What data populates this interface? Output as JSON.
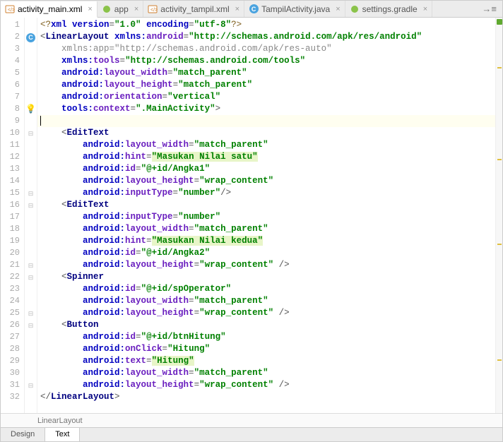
{
  "tabs": {
    "items": [
      {
        "label": "activity_main.xml",
        "icon": "xml",
        "active": true
      },
      {
        "label": "app",
        "icon": "gradle",
        "active": false
      },
      {
        "label": "activity_tampil.xml",
        "icon": "xml",
        "active": false
      },
      {
        "label": "TampilActivity.java",
        "icon": "java",
        "active": false
      },
      {
        "label": "settings.gradle",
        "icon": "gradle",
        "active": false
      }
    ]
  },
  "code": {
    "lines": [
      {
        "n": 1,
        "m": "",
        "seg": [
          [
            "decl",
            "<?"
          ],
          [
            "attr",
            "xml version"
          ],
          [
            "punct",
            "="
          ],
          [
            "str",
            "\"1.0\""
          ],
          [
            "punct",
            " "
          ],
          [
            "attr",
            "encoding"
          ],
          [
            "punct",
            "="
          ],
          [
            "str",
            "\"utf-8\""
          ],
          [
            "decl",
            "?>"
          ]
        ]
      },
      {
        "n": 2,
        "m": "class",
        "seg": [
          [
            "punct",
            "<"
          ],
          [
            "tagc",
            "LinearLayout "
          ],
          [
            "attr",
            "xmlns:"
          ],
          [
            "attrn",
            "android"
          ],
          [
            "punct",
            "="
          ],
          [
            "str",
            "\"http://schemas.android.com/apk/res/android\""
          ]
        ]
      },
      {
        "n": 3,
        "m": "",
        "seg": [
          [
            "nsgray",
            "    xmlns:app=\"http://schemas.android.com/apk/res-auto\""
          ]
        ]
      },
      {
        "n": 4,
        "m": "",
        "seg": [
          [
            "punct",
            "    "
          ],
          [
            "attr",
            "xmlns:"
          ],
          [
            "attrn",
            "tools"
          ],
          [
            "punct",
            "="
          ],
          [
            "str",
            "\"http://schemas.android.com/tools\""
          ]
        ]
      },
      {
        "n": 5,
        "m": "",
        "seg": [
          [
            "punct",
            "    "
          ],
          [
            "attr",
            "android:"
          ],
          [
            "attrn",
            "layout_width"
          ],
          [
            "punct",
            "="
          ],
          [
            "str",
            "\"match_parent\""
          ]
        ]
      },
      {
        "n": 6,
        "m": "",
        "seg": [
          [
            "punct",
            "    "
          ],
          [
            "attr",
            "android:"
          ],
          [
            "attrn",
            "layout_height"
          ],
          [
            "punct",
            "="
          ],
          [
            "str",
            "\"match_parent\""
          ]
        ]
      },
      {
        "n": 7,
        "m": "",
        "seg": [
          [
            "punct",
            "    "
          ],
          [
            "attr",
            "android:"
          ],
          [
            "attrn",
            "orientation"
          ],
          [
            "punct",
            "="
          ],
          [
            "str",
            "\"vertical\""
          ]
        ]
      },
      {
        "n": 8,
        "m": "bulb",
        "seg": [
          [
            "punct",
            "    "
          ],
          [
            "attr",
            "tools:"
          ],
          [
            "attrn",
            "context"
          ],
          [
            "punct",
            "="
          ],
          [
            "str",
            "\".MainActivity\""
          ],
          [
            "punct",
            ">"
          ]
        ]
      },
      {
        "n": 9,
        "m": "",
        "hl": true,
        "cursor": true,
        "seg": []
      },
      {
        "n": 10,
        "m": "fold",
        "seg": [
          [
            "punct",
            "    <"
          ],
          [
            "tagc",
            "EditText"
          ]
        ]
      },
      {
        "n": 11,
        "m": "",
        "seg": [
          [
            "punct",
            "        "
          ],
          [
            "attr",
            "android:"
          ],
          [
            "attrn",
            "layout_width"
          ],
          [
            "punct",
            "="
          ],
          [
            "str",
            "\"match_parent\""
          ]
        ]
      },
      {
        "n": 12,
        "m": "",
        "seg": [
          [
            "punct",
            "        "
          ],
          [
            "attr",
            "android:"
          ],
          [
            "attrn",
            "hint"
          ],
          [
            "punct",
            "="
          ],
          [
            "hint",
            "\"Masukan Nilai satu\""
          ]
        ]
      },
      {
        "n": 13,
        "m": "",
        "seg": [
          [
            "punct",
            "        "
          ],
          [
            "attr",
            "android:"
          ],
          [
            "attrn",
            "id"
          ],
          [
            "punct",
            "="
          ],
          [
            "str",
            "\"@+id/Angka1\""
          ]
        ]
      },
      {
        "n": 14,
        "m": "",
        "seg": [
          [
            "punct",
            "        "
          ],
          [
            "attr",
            "android:"
          ],
          [
            "attrn",
            "layout_height"
          ],
          [
            "punct",
            "="
          ],
          [
            "str",
            "\"wrap_content\""
          ]
        ]
      },
      {
        "n": 15,
        "m": "foldend",
        "seg": [
          [
            "punct",
            "        "
          ],
          [
            "attr",
            "android:"
          ],
          [
            "attrn",
            "inputType"
          ],
          [
            "punct",
            "="
          ],
          [
            "str",
            "\"number\""
          ],
          [
            "punct",
            "/>"
          ]
        ]
      },
      {
        "n": 16,
        "m": "fold",
        "seg": [
          [
            "punct",
            "    <"
          ],
          [
            "tagc",
            "EditText"
          ]
        ]
      },
      {
        "n": 17,
        "m": "",
        "seg": [
          [
            "punct",
            "        "
          ],
          [
            "attr",
            "android:"
          ],
          [
            "attrn",
            "inputType"
          ],
          [
            "punct",
            "="
          ],
          [
            "str",
            "\"number\""
          ]
        ]
      },
      {
        "n": 18,
        "m": "",
        "seg": [
          [
            "punct",
            "        "
          ],
          [
            "attr",
            "android:"
          ],
          [
            "attrn",
            "layout_width"
          ],
          [
            "punct",
            "="
          ],
          [
            "str",
            "\"match_parent\""
          ]
        ]
      },
      {
        "n": 19,
        "m": "",
        "seg": [
          [
            "punct",
            "        "
          ],
          [
            "attr",
            "android:"
          ],
          [
            "attrn",
            "hint"
          ],
          [
            "punct",
            "="
          ],
          [
            "hint",
            "\"Masukan Nilai kedua\""
          ]
        ]
      },
      {
        "n": 20,
        "m": "",
        "seg": [
          [
            "punct",
            "        "
          ],
          [
            "attr",
            "android:"
          ],
          [
            "attrn",
            "id"
          ],
          [
            "punct",
            "="
          ],
          [
            "str",
            "\"@+id/Angka2\""
          ]
        ]
      },
      {
        "n": 21,
        "m": "foldend",
        "seg": [
          [
            "punct",
            "        "
          ],
          [
            "attr",
            "android:"
          ],
          [
            "attrn",
            "layout_height"
          ],
          [
            "punct",
            "="
          ],
          [
            "str",
            "\"wrap_content\""
          ],
          [
            "punct",
            " />"
          ]
        ]
      },
      {
        "n": 22,
        "m": "fold",
        "seg": [
          [
            "punct",
            "    <"
          ],
          [
            "tagc",
            "Spinner"
          ]
        ]
      },
      {
        "n": 23,
        "m": "",
        "seg": [
          [
            "punct",
            "        "
          ],
          [
            "attr",
            "android:"
          ],
          [
            "attrn",
            "id"
          ],
          [
            "punct",
            "="
          ],
          [
            "str",
            "\"@+id/spOperator\""
          ]
        ]
      },
      {
        "n": 24,
        "m": "",
        "seg": [
          [
            "punct",
            "        "
          ],
          [
            "attr",
            "android:"
          ],
          [
            "attrn",
            "layout_width"
          ],
          [
            "punct",
            "="
          ],
          [
            "str",
            "\"match_parent\""
          ]
        ]
      },
      {
        "n": 25,
        "m": "foldend",
        "seg": [
          [
            "punct",
            "        "
          ],
          [
            "attr",
            "android:"
          ],
          [
            "attrn",
            "layout_height"
          ],
          [
            "punct",
            "="
          ],
          [
            "str",
            "\"wrap_content\""
          ],
          [
            "punct",
            " />"
          ]
        ]
      },
      {
        "n": 26,
        "m": "fold",
        "seg": [
          [
            "punct",
            "    <"
          ],
          [
            "tagc",
            "Button"
          ]
        ]
      },
      {
        "n": 27,
        "m": "",
        "seg": [
          [
            "punct",
            "        "
          ],
          [
            "attr",
            "android:"
          ],
          [
            "attrn",
            "id"
          ],
          [
            "punct",
            "="
          ],
          [
            "str",
            "\"@+id/btnHitung\""
          ]
        ]
      },
      {
        "n": 28,
        "m": "",
        "seg": [
          [
            "punct",
            "        "
          ],
          [
            "attr",
            "android:"
          ],
          [
            "attrn",
            "onClick"
          ],
          [
            "punct",
            "="
          ],
          [
            "str",
            "\"Hitung\""
          ]
        ]
      },
      {
        "n": 29,
        "m": "",
        "seg": [
          [
            "punct",
            "        "
          ],
          [
            "attr",
            "android:"
          ],
          [
            "attrn",
            "text"
          ],
          [
            "punct",
            "="
          ],
          [
            "hint",
            "\"Hitung\""
          ]
        ]
      },
      {
        "n": 30,
        "m": "",
        "seg": [
          [
            "punct",
            "        "
          ],
          [
            "attr",
            "android:"
          ],
          [
            "attrn",
            "layout_width"
          ],
          [
            "punct",
            "="
          ],
          [
            "str",
            "\"match_parent\""
          ]
        ]
      },
      {
        "n": 31,
        "m": "foldend",
        "seg": [
          [
            "punct",
            "        "
          ],
          [
            "attr",
            "android:"
          ],
          [
            "attrn",
            "layout_height"
          ],
          [
            "punct",
            "="
          ],
          [
            "str",
            "\"wrap_content\""
          ],
          [
            "punct",
            " />"
          ]
        ]
      },
      {
        "n": 32,
        "m": "",
        "seg": [
          [
            "punct",
            "</"
          ],
          [
            "tagc",
            "LinearLayout"
          ],
          [
            "punct",
            ">"
          ]
        ]
      }
    ]
  },
  "breadcrumb": {
    "path": "LinearLayout"
  },
  "bottomTabs": {
    "items": [
      {
        "label": "Design",
        "active": false
      },
      {
        "label": "Text",
        "active": true
      }
    ]
  }
}
